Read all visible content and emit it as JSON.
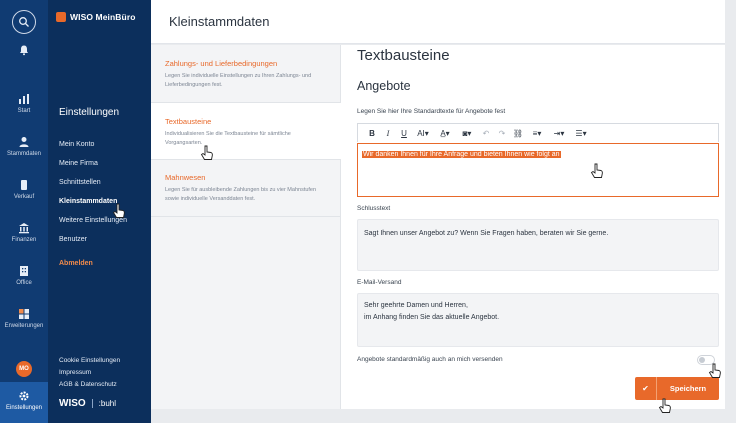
{
  "rail": {
    "items": [
      {
        "label": "Start",
        "icon": "chart-icon"
      },
      {
        "label": "Stammdaten",
        "icon": "person-icon"
      },
      {
        "label": "Verkauf",
        "icon": "cart-icon"
      },
      {
        "label": "Finanzen",
        "icon": "bank-icon"
      },
      {
        "label": "Office",
        "icon": "building-icon"
      },
      {
        "label": "Erweiterungen",
        "icon": "puzzle-icon"
      },
      {
        "label": "Einstellungen",
        "icon": "gear-icon"
      }
    ],
    "avatar_initials": "MO"
  },
  "brand": {
    "name": "WISO MeinBüro",
    "footer_wiso": "WISO",
    "footer_wiso_sub": "software",
    "footer_buhl": ":buhl"
  },
  "nav": {
    "title": "Einstellungen",
    "items": [
      "Mein Konto",
      "Meine Firma",
      "Schnittstellen",
      "Kleinstammdaten",
      "Weitere Einstellungen",
      "Benutzer"
    ],
    "selected": "Kleinstammdaten",
    "logout": "Abmelden",
    "bottom": [
      "Cookie Einstellungen",
      "Impressum",
      "AGB & Datenschutz"
    ]
  },
  "header": {
    "title": "Kleinstammdaten"
  },
  "sublist": [
    {
      "title": "Zahlungs- und Lieferbedingungen",
      "desc": "Legen Sie individuelle Einstellungen zu Ihren Zahlungs- und Lieferbedingungen fest."
    },
    {
      "title": "Textbausteine",
      "desc": "Individualisieren Sie die Textbausteine für sämtliche Vorgangsarten."
    },
    {
      "title": "Mahnwesen",
      "desc": "Legen Sie für ausbleibende Zahlungen bis zu vier Mahnstufen sowie individuelle Versanddaten fest."
    }
  ],
  "main": {
    "heading": "Textbausteine",
    "subheading": "Angebote",
    "intro_label": "Legen Sie hier Ihre Standardtexte für Angebote fest",
    "editor_text": "Wir danken Ihnen für Ihre Anfrage und bieten Ihnen wie folgt an",
    "closing_label": "Schlusstext",
    "closing_text": "Sagt Ihnen unser Angebot zu? Wenn Sie Fragen haben, beraten wir Sie gerne.",
    "email_label": "E-Mail-Versand",
    "email_line1": "Sehr geehrte Damen und Herren,",
    "email_line2": "im Anhang finden Sie das aktuelle Angebot.",
    "toggle_label": "Angebote standardmäßig auch an mich versenden",
    "save_label": "Speichern"
  },
  "colors": {
    "accent": "#e8692a",
    "rail": "#103b72",
    "nav": "#0c2f5c"
  }
}
